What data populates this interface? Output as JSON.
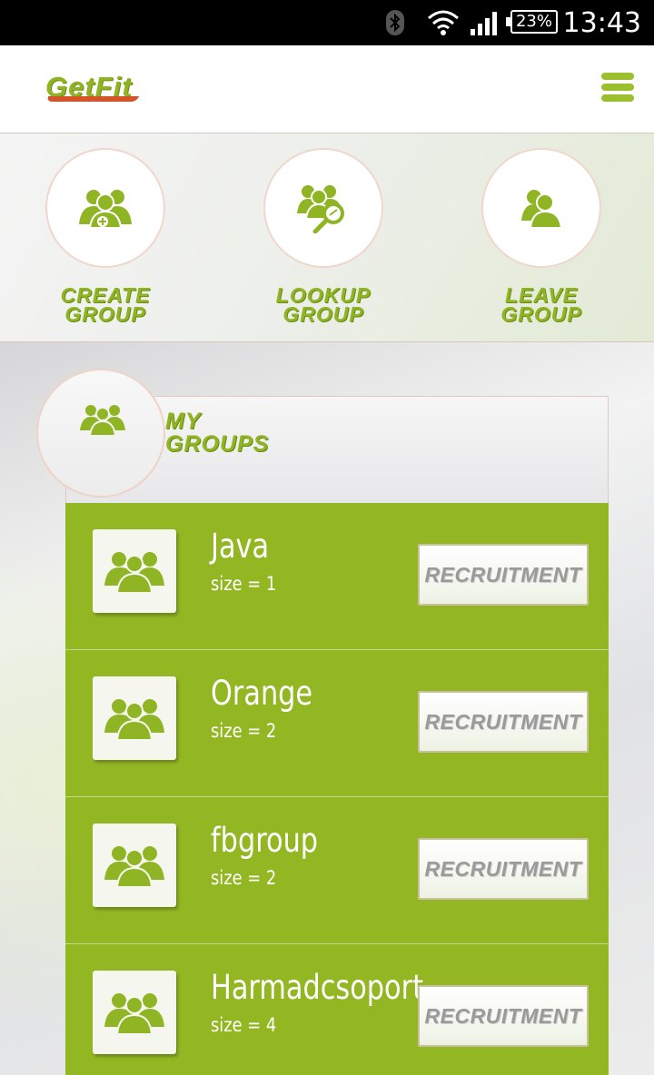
{
  "status_bar": {
    "battery": "23%",
    "time": "13:43"
  },
  "header": {
    "logo": "GetFit",
    "menu_icon": "hamburger-icon"
  },
  "actions": [
    {
      "label": "CREATE\nGROUP",
      "icon": "group-add-icon"
    },
    {
      "label": "LOOKUP\nGROUP",
      "icon": "group-search-icon"
    },
    {
      "label": "LEAVE\nGROUP",
      "icon": "group-leave-icon"
    }
  ],
  "my_groups": {
    "title": "MY\nGROUPS",
    "icon": "group-icon"
  },
  "groups": [
    {
      "name": "Java",
      "size": "size = 1",
      "button": "RECRUITMENT"
    },
    {
      "name": "Orange",
      "size": "size = 2",
      "button": "RECRUITMENT"
    },
    {
      "name": "fbgroup",
      "size": "size = 2",
      "button": "RECRUITMENT"
    },
    {
      "name": "Harmadcsoport",
      "size": "size = 4",
      "button": "RECRUITMENT"
    }
  ],
  "colors": {
    "accent": "#93b623",
    "accent_text": "#8fb424",
    "logo_swoosh": "#d2552a"
  }
}
